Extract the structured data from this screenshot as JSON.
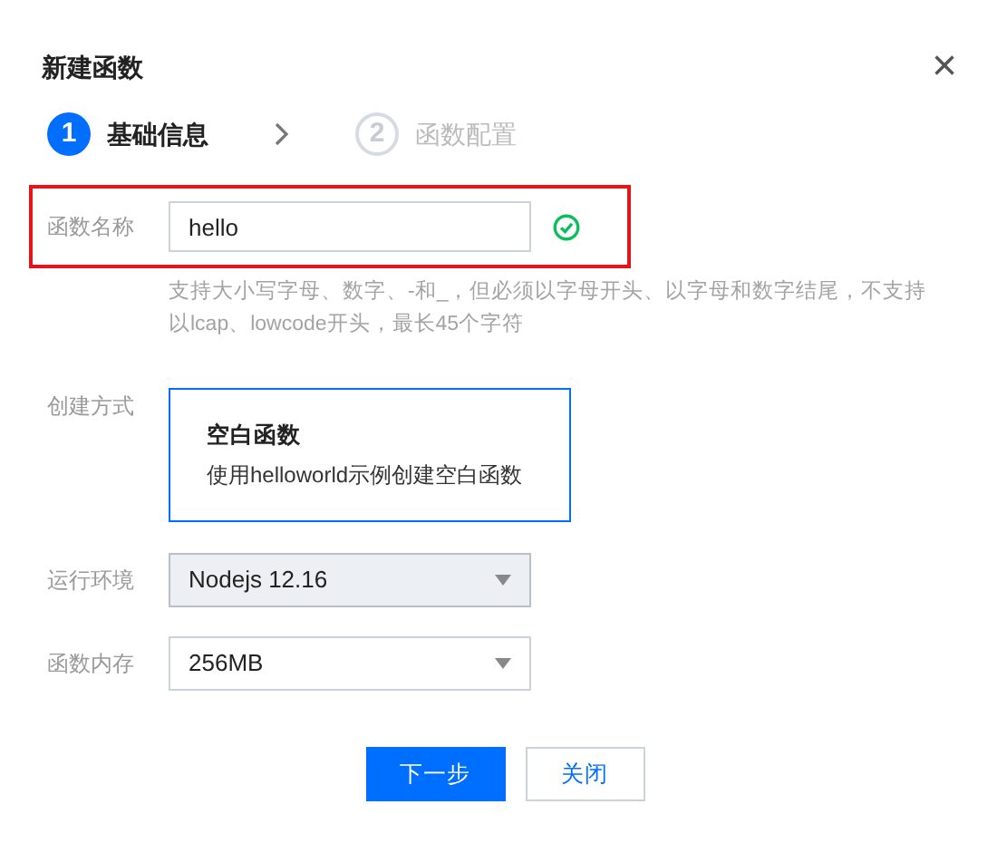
{
  "dialog": {
    "title": "新建函数",
    "close": "×"
  },
  "steps": [
    {
      "number": "1",
      "label": "基础信息",
      "selected": true
    },
    {
      "number": "2",
      "label": "函数配置",
      "selected": false
    }
  ],
  "form": [
    {
      "kind": "text",
      "label": "函数名称",
      "value": "hello",
      "valid": true,
      "highlighted": true,
      "hint": "支持大小写字母、数字、-和_，但必须以字母开头、以字母和数字结尾，不支持以lcap、lowcode开头，最长45个字符"
    },
    {
      "kind": "card",
      "label": "创建方式",
      "selected": true,
      "title": "空白函数",
      "description": "使用helloworld示例创建空白函数"
    },
    {
      "kind": "select",
      "label": "运行环境",
      "value": "Nodejs 12.16",
      "disabled": true
    },
    {
      "kind": "select",
      "label": "函数内存",
      "value": "256MB",
      "disabled": false
    }
  ],
  "buttons": [
    {
      "label": "下一步",
      "primary": true
    },
    {
      "label": "关闭",
      "primary": false
    }
  ]
}
